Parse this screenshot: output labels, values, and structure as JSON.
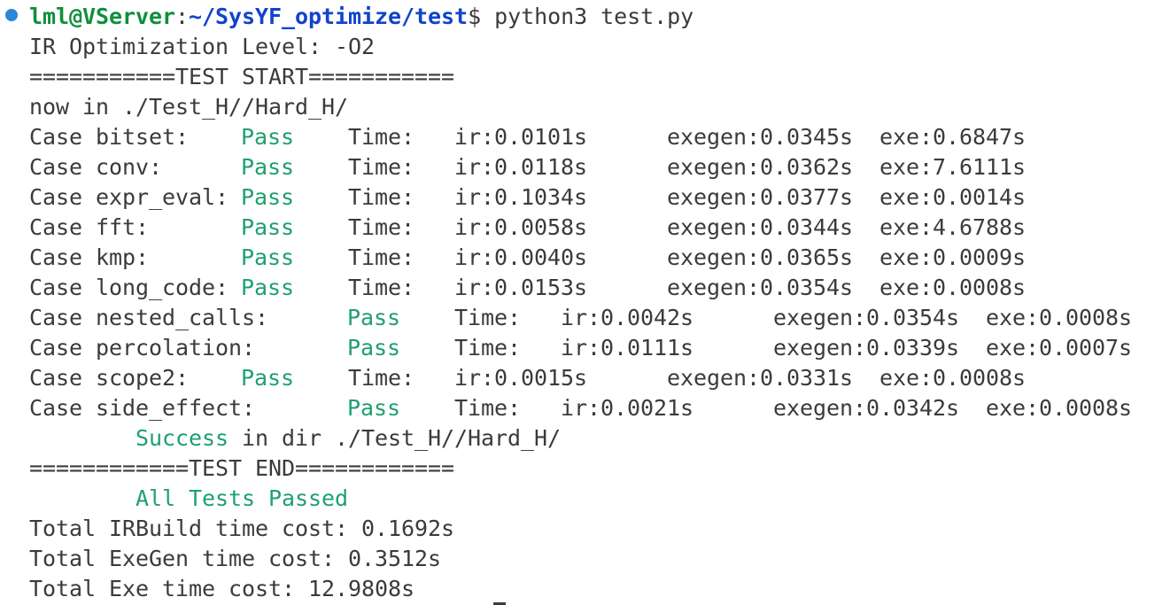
{
  "prompt": {
    "user_host": "lml@VServer",
    "separator": ":",
    "path": "~/SysYF_optimize/test",
    "symbol": "$",
    "command": " python3 test.py"
  },
  "header_lines": {
    "opt_level": "IR Optimization Level: -O2",
    "test_start": "===========TEST START===========",
    "now_in": "now in ./Test_H//Hard_H/"
  },
  "cases": [
    {
      "label": "Case bitset:",
      "status": "Pass",
      "time": "Time:",
      "ir": "ir:0.0101s",
      "exegen": "exegen:0.0345s",
      "exe": "exe:0.6847s",
      "long": false
    },
    {
      "label": "Case conv:",
      "status": "Pass",
      "time": "Time:",
      "ir": "ir:0.0118s",
      "exegen": "exegen:0.0362s",
      "exe": "exe:7.6111s",
      "long": false
    },
    {
      "label": "Case expr_eval:",
      "status": "Pass",
      "time": "Time:",
      "ir": "ir:0.1034s",
      "exegen": "exegen:0.0377s",
      "exe": "exe:0.0014s",
      "long": false
    },
    {
      "label": "Case fft:",
      "status": "Pass",
      "time": "Time:",
      "ir": "ir:0.0058s",
      "exegen": "exegen:0.0344s",
      "exe": "exe:4.6788s",
      "long": false
    },
    {
      "label": "Case kmp:",
      "status": "Pass",
      "time": "Time:",
      "ir": "ir:0.0040s",
      "exegen": "exegen:0.0365s",
      "exe": "exe:0.0009s",
      "long": false
    },
    {
      "label": "Case long_code:",
      "status": "Pass",
      "time": "Time:",
      "ir": "ir:0.0153s",
      "exegen": "exegen:0.0354s",
      "exe": "exe:0.0008s",
      "long": false
    },
    {
      "label": "Case nested_calls:",
      "status": "Pass",
      "time": "Time:",
      "ir": "ir:0.0042s",
      "exegen": "exegen:0.0354s",
      "exe": "exe:0.0008s",
      "long": true
    },
    {
      "label": "Case percolation:",
      "status": "Pass",
      "time": "Time:",
      "ir": "ir:0.0111s",
      "exegen": "exegen:0.0339s",
      "exe": "exe:0.0007s",
      "long": true
    },
    {
      "label": "Case scope2:",
      "status": "Pass",
      "time": "Time:",
      "ir": "ir:0.0015s",
      "exegen": "exegen:0.0331s",
      "exe": "exe:0.0008s",
      "long": false
    },
    {
      "label": "Case side_effect:",
      "status": "Pass",
      "time": "Time:",
      "ir": "ir:0.0021s",
      "exegen": "exegen:0.0342s",
      "exe": "exe:0.0008s",
      "long": true
    }
  ],
  "footer": {
    "success_word": "Success",
    "success_rest": " in dir ./Test_H//Hard_H/",
    "test_end": "============TEST END============",
    "all_passed": "All Tests Passed",
    "total_irbuild": "Total IRBuild time cost: 0.1692s",
    "total_exegen": "Total ExeGen time cost: 0.3512s",
    "total_exe": "Total Exe time cost: 12.9808s"
  },
  "colors": {
    "pass_green": "#1ea06e",
    "prompt_green": "#0f8f3b",
    "prompt_blue": "#1144cc",
    "text": "#3b3b3b",
    "background": "#ffffff"
  }
}
